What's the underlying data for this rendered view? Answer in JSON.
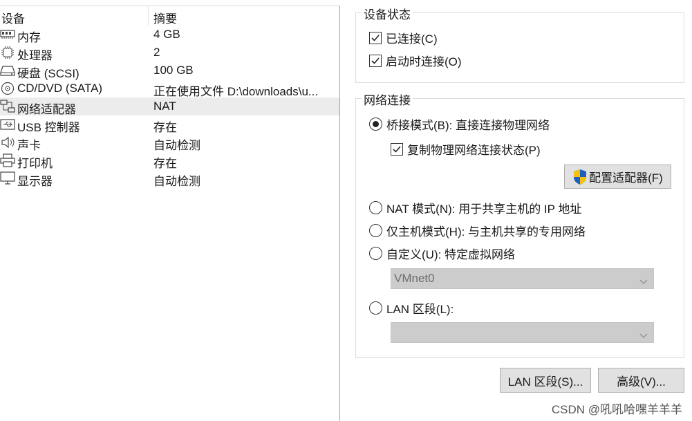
{
  "device_list": {
    "header_device": "设备",
    "header_summary": "摘要",
    "items": [
      {
        "icon": "memory-icon",
        "name": "内存",
        "summary": "4 GB"
      },
      {
        "icon": "processor-icon",
        "name": "处理器",
        "summary": "2"
      },
      {
        "icon": "hard-disk-icon",
        "name": "硬盘 (SCSI)",
        "summary": "100 GB"
      },
      {
        "icon": "cd-dvd-icon",
        "name": "CD/DVD (SATA)",
        "summary": "正在使用文件 D:\\downloads\\u..."
      },
      {
        "icon": "network-adapter-icon",
        "name": "网络适配器",
        "summary": "NAT",
        "selected": true
      },
      {
        "icon": "usb-icon",
        "name": "USB 控制器",
        "summary": "存在"
      },
      {
        "icon": "sound-icon",
        "name": "声卡",
        "summary": "自动检测"
      },
      {
        "icon": "printer-icon",
        "name": "打印机",
        "summary": "存在"
      },
      {
        "icon": "display-icon",
        "name": "显示器",
        "summary": "自动检测"
      }
    ]
  },
  "device_status": {
    "title": "设备状态",
    "connected_label": "已连接(C)",
    "connected_checked": true,
    "connect_on_power_label": "启动时连接(O)",
    "connect_on_power_checked": true
  },
  "network_connection": {
    "title": "网络连接",
    "bridged_label": "桥接模式(B): 直接连接物理网络",
    "bridged_selected": true,
    "replicate_label": "复制物理网络连接状态(P)",
    "replicate_checked": true,
    "configure_adapters_label": "配置适配器(F)",
    "nat_label": "NAT 模式(N): 用于共享主机的 IP 地址",
    "host_only_label": "仅主机模式(H): 与主机共享的专用网络",
    "custom_label": "自定义(U): 特定虚拟网络",
    "custom_network_value": "VMnet0",
    "lan_segment_label": "LAN 区段(L):",
    "lan_segment_value": ""
  },
  "buttons": {
    "lan_segments": "LAN 区段(S)...",
    "advanced": "高级(V)..."
  },
  "watermark": "CSDN @吼吼哈嘿羊羊羊",
  "colors": {
    "selected_row": "#ececec",
    "disabled_combo": "#cccccc",
    "shield_blue": "#1e5fbf",
    "shield_yellow": "#f2c20e"
  }
}
